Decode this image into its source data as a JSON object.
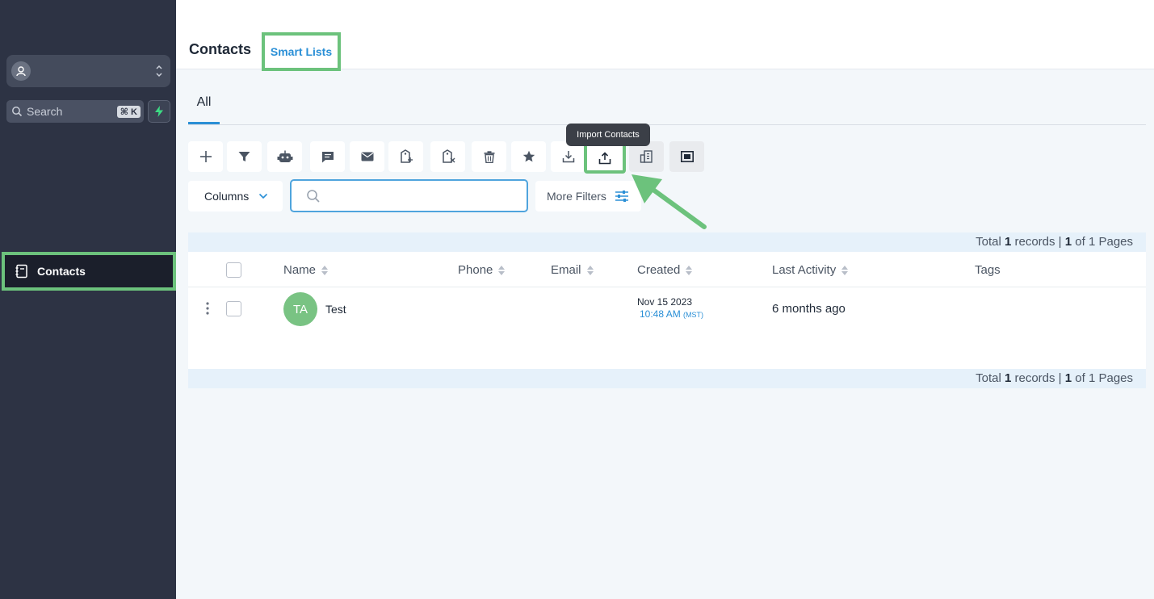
{
  "sidebar": {
    "search_label": "Search",
    "search_shortcut": "⌘ K",
    "nav_contacts": "Contacts"
  },
  "header": {
    "title": "Contacts",
    "smart_lists": "Smart Lists"
  },
  "tabs": {
    "all": "All"
  },
  "toolbar": {
    "icons": [
      "plus-icon",
      "filter-icon",
      "robot-icon",
      "sms-icon",
      "email-icon",
      "add-tag-icon",
      "remove-tag-icon",
      "trash-icon",
      "star-icon",
      "download-icon",
      "import-icon",
      "company-icon",
      "merge-icon"
    ],
    "tooltip": "Import Contacts"
  },
  "filters": {
    "columns_label": "Columns",
    "search_placeholder": "",
    "more_filters_label": "More Filters"
  },
  "pager": {
    "total_prefix": "Total",
    "total_count": "1",
    "records_sep": "records |",
    "page": "1",
    "of_pages": "of 1 Pages"
  },
  "table": {
    "columns": [
      "Name",
      "Phone",
      "Email",
      "Created",
      "Last Activity",
      "Tags"
    ],
    "rows": [
      {
        "initials": "TA",
        "name": "Test",
        "created_date": "Nov 15 2023",
        "created_time": "10:48 AM",
        "created_tz": "(MST)",
        "last_activity": "6 months ago"
      }
    ]
  },
  "colors": {
    "sidebar_bg": "#2d3344",
    "highlight": "#6cc27c",
    "accent": "#2a8fd6",
    "avatar": "#79c383"
  }
}
